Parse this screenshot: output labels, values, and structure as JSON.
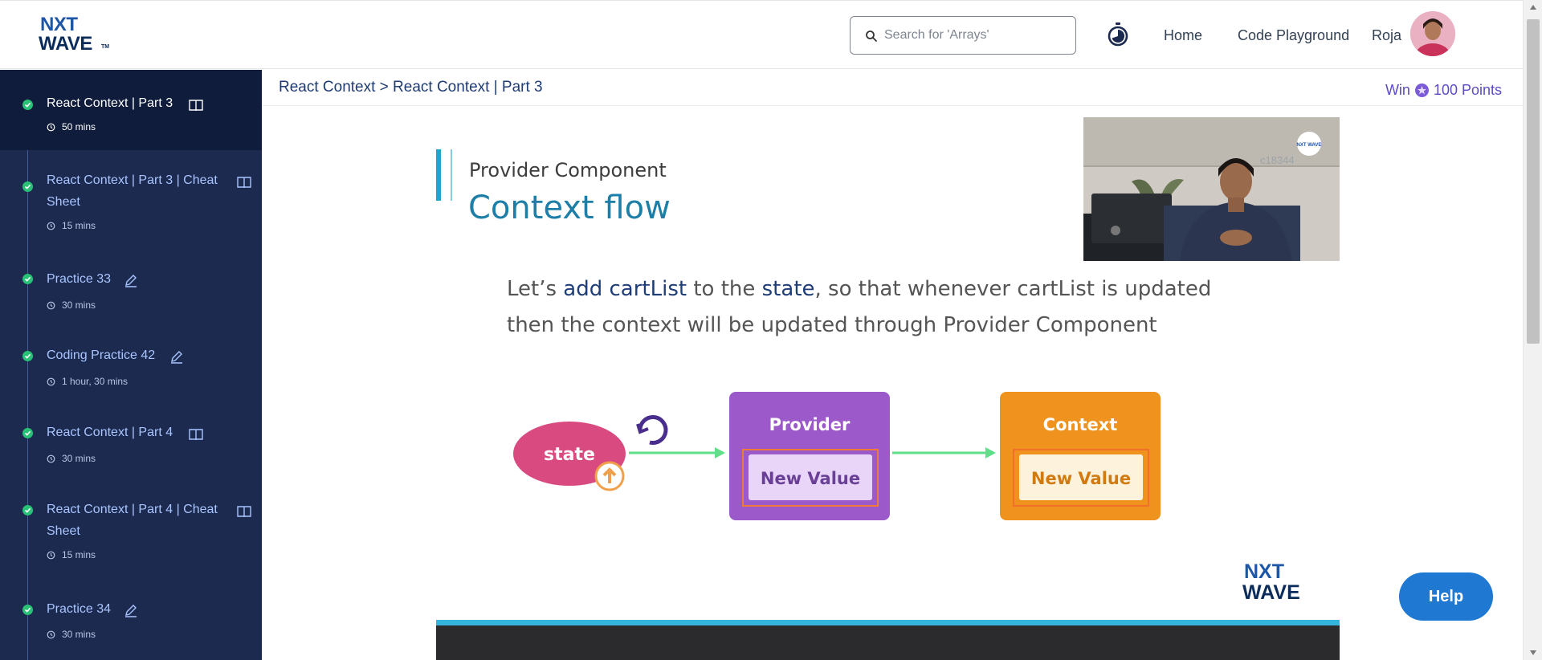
{
  "header": {
    "logo_top": "NXT",
    "logo_bottom": "WAVE",
    "logo_tm": "TM",
    "search_placeholder": "Search for 'Arrays'",
    "nav_home": "Home",
    "nav_playground": "Code Playground",
    "user_name": "Roja"
  },
  "sidebar": {
    "items": [
      {
        "title": "React Context | Part 3",
        "time": "50 mins",
        "icon": "book-icon",
        "active": true
      },
      {
        "title": "React Context | Part 3 | Cheat Sheet",
        "time": "15 mins",
        "icon": "book-icon",
        "active": false
      },
      {
        "title": "Practice 33",
        "time": "30 mins",
        "icon": "pencil-icon",
        "active": false
      },
      {
        "title": "Coding Practice 42",
        "time": "1 hour, 30 mins",
        "icon": "pencil-icon",
        "active": false
      },
      {
        "title": "React Context | Part 4",
        "time": "30 mins",
        "icon": "book-icon",
        "active": false
      },
      {
        "title": "React Context | Part 4 | Cheat Sheet",
        "time": "15 mins",
        "icon": "book-icon",
        "active": false
      },
      {
        "title": "Practice 34",
        "time": "30 mins",
        "icon": "pencil-icon",
        "active": false
      }
    ]
  },
  "main": {
    "breadcrumb": "React Context > React Context | Part 3",
    "win_prefix": "Win",
    "win_points": "100 Points"
  },
  "video": {
    "subtitle": "Provider Component",
    "title": "Context flow",
    "body_parts": [
      "Let’s ",
      "add cartList",
      " to the ",
      "state",
      ", so that whenever cartList is updated then the context will be updated through Provider Component"
    ],
    "diagram": {
      "state_label": "state",
      "provider_label": "Provider",
      "provider_value": "New Value",
      "context_label": "Context",
      "context_value": "New Value"
    },
    "logo_top": "NXT",
    "logo_bottom": "WAVE",
    "pip_watermark": "c18344",
    "pip_logo": "NXT WAVE"
  },
  "help_label": "Help",
  "colors": {
    "sidebar_bg": "#1b2a4e",
    "sidebar_active": "#0f1c3b",
    "check_green": "#29c175",
    "provider_purple": "#9b59c9",
    "context_orange": "#f0931e",
    "state_pink": "#d84a80",
    "help_blue": "#1f78d1"
  }
}
